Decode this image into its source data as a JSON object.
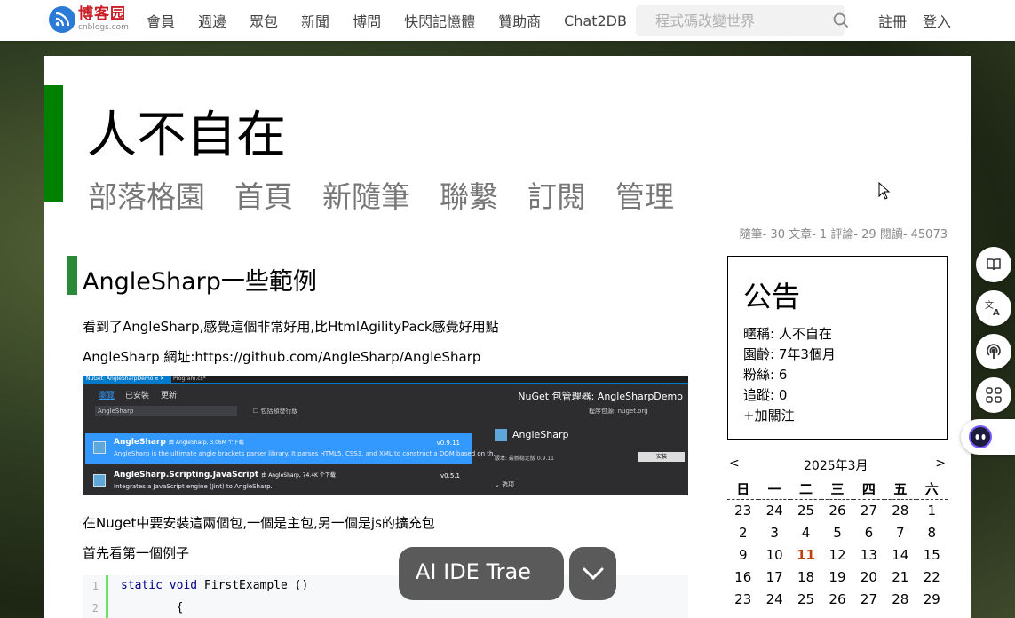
{
  "topnav": {
    "logo_cn": "博客园",
    "logo_en": "cnblogs.com",
    "items": [
      "會員",
      "週邊",
      "眾包",
      "新聞",
      "博問",
      "快閃記憶體",
      "贊助商",
      "Chat2DB"
    ],
    "search_placeholder": "程式碼改變世界",
    "register": "註冊",
    "login": "登入"
  },
  "blog": {
    "title": "人不自在",
    "nav": [
      "部落格園",
      "首頁",
      "新隨筆",
      "聯繫",
      "訂閱",
      "管理"
    ],
    "stats": "隨筆- 30  文章- 1  評論- 29  閱讀- 45073"
  },
  "post": {
    "title": "AngleSharp一些範例",
    "p1": "看到了AngleSharp,感覺這個非常好用,比HtmlAgilityPack感覺好用點",
    "p2": "AngleSharp 網址:https://github.com/AngleSharp/AngleSharp",
    "p3": "在Nuget中要安裝這兩個包,一個是主包,另一個是js的擴充包",
    "p4": "首先看第一個例子",
    "code": [
      {
        "n": "1",
        "kw": "static void",
        "rest": " FirstExample ()"
      },
      {
        "n": "2",
        "kw": "",
        "rest": "        {"
      }
    ]
  },
  "nuget": {
    "tab1": "NuGet: AngleSharpDemo  ¤  ✕",
    "tab2": "Program.cs*",
    "sub_browse": "瀏覽",
    "sub_installed": "已安裝",
    "sub_updates": "更新",
    "header": "NuGet 包管理器: AngleSharpDemo",
    "search": "AngleSharp",
    "prerelease": "包括預發行版",
    "source": "程序包源:  nuget.org",
    "items": [
      {
        "name": "AngleSharp",
        "by": "由 AngleSharp, 3.06M 个下载",
        "desc": "AngleSharp is the ultimate angle brackets parser library. It parses HTML5, CSS3, and XML to construct a DOM based on th...",
        "ver": "v0.9.11"
      },
      {
        "name": "AngleSharp.Scripting.JavaScript",
        "by": "由 AngleSharp, 74.4K 个下载",
        "desc": "Integrates a JavaScript engine (Jint) to AngleSharp.",
        "ver": "v0.5.1"
      }
    ],
    "detail_name": "AngleSharp",
    "detail_ver": "版本:  最新稳定版 0.9.11",
    "install": "安装",
    "options": "选项"
  },
  "notice": {
    "title": "公告",
    "rows": [
      "暱稱:  人不自在",
      "園齡:  7年3個月",
      "粉絲:  6",
      "追蹤:  0",
      "+加關注"
    ]
  },
  "calendar": {
    "prev": "<",
    "next": ">",
    "month": "2025年3月",
    "weekdays": [
      "日",
      "一",
      "二",
      "三",
      "四",
      "五",
      "六"
    ],
    "weeks": [
      [
        "23",
        "24",
        "25",
        "26",
        "27",
        "28",
        "1"
      ],
      [
        "2",
        "3",
        "4",
        "5",
        "6",
        "7",
        "8"
      ],
      [
        "9",
        "10",
        "11",
        "12",
        "13",
        "14",
        "15"
      ],
      [
        "16",
        "17",
        "18",
        "19",
        "20",
        "21",
        "22"
      ],
      [
        "23",
        "24",
        "25",
        "26",
        "27",
        "28",
        "29"
      ]
    ],
    "today": "11"
  },
  "overlay": {
    "ide_label": "AI IDE Trae"
  }
}
